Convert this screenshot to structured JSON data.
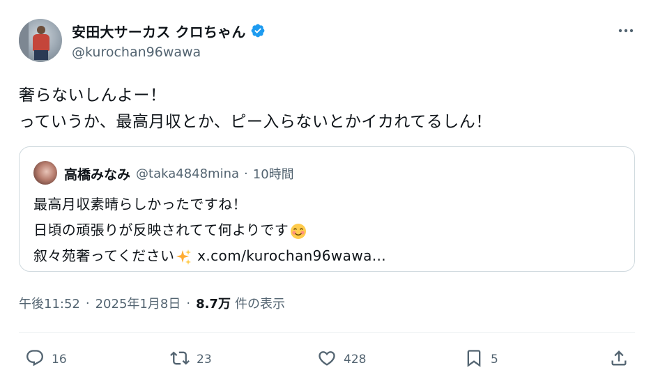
{
  "author": {
    "display_name": "安田大サーカス クロちゃん",
    "handle": "@kurochan96wawa",
    "verified": true
  },
  "tweet": {
    "lines": [
      "奢らないしんよー！",
      "っていうか、最高月収とか、ピー入らないとかイカれてるしん！"
    ]
  },
  "quote": {
    "display_name": "高橋みなみ",
    "handle": "@taka4848mina",
    "dot": "·",
    "time": "10時間",
    "lines": [
      "最高月収素晴らしかったですね！",
      "日頃の頑張りが反映されてて何よりです",
      "叙々苑奢ってください",
      " x.com/kurochan96wawa..."
    ],
    "emoji": [
      "smiling-face-emoji",
      "sparkles-emoji"
    ]
  },
  "meta": {
    "time": "午後11:52",
    "sep": "·",
    "date": "2025年1月8日",
    "views": "8.7万",
    "views_label": "件の表示"
  },
  "actions": {
    "reply": "16",
    "retweet": "23",
    "like": "428",
    "bookmark": "5"
  },
  "colors": {
    "text": "#0f1419",
    "secondary": "#536471",
    "verified": "#1d9bf0",
    "border": "#cfd9de"
  }
}
